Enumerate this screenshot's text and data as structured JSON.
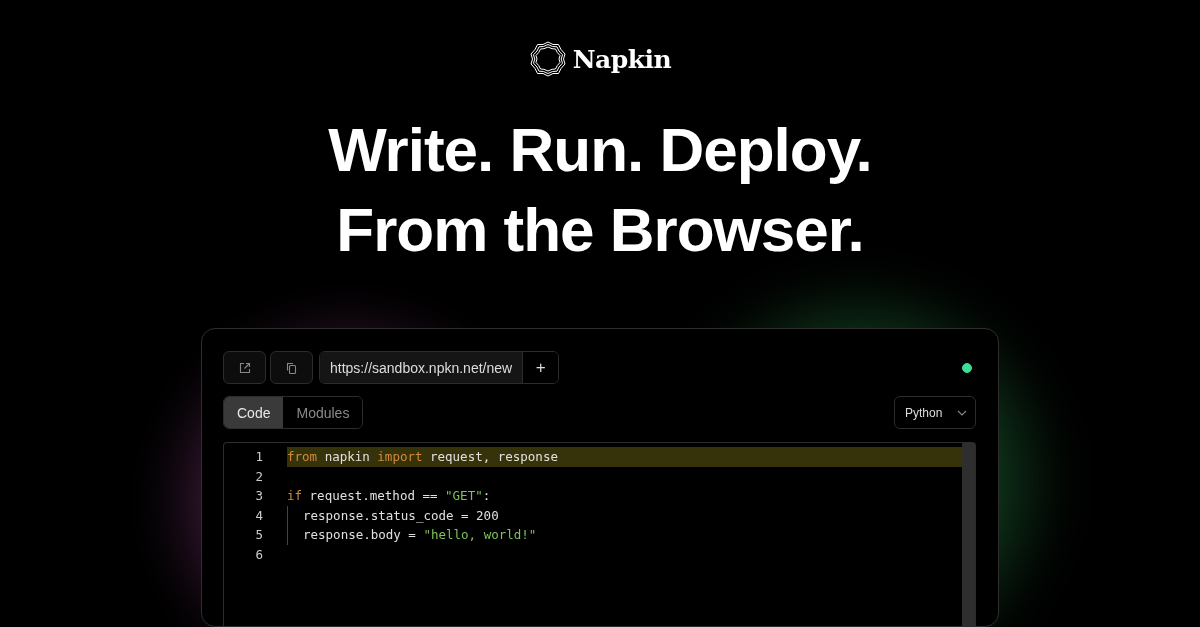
{
  "brand": {
    "name": "Napkin"
  },
  "headline": [
    "Write. Run. Deploy.",
    "From the Browser."
  ],
  "editor_window": {
    "toolbar": {
      "url": "https://sandbox.npkn.net/new",
      "add_label": "+",
      "connected": true
    },
    "tabs": [
      {
        "label": "Code",
        "selected": true
      },
      {
        "label": "Modules",
        "selected": false
      }
    ],
    "language": "Python",
    "lines": [
      {
        "number": "1",
        "active": true,
        "indented": false,
        "tokens": [
          {
            "kind": "keyword",
            "text": "from"
          },
          {
            "kind": "plain",
            "text": " napkin "
          },
          {
            "kind": "keyword",
            "text": "import"
          },
          {
            "kind": "plain",
            "text": " request, response"
          }
        ]
      },
      {
        "number": "2",
        "active": false,
        "indented": false
      },
      {
        "number": "3",
        "active": false,
        "indented": false,
        "tokens": [
          {
            "kind": "keyword",
            "text": "if"
          },
          {
            "kind": "plain",
            "text": " request.method == "
          },
          {
            "kind": "string",
            "text": "\"GET\""
          },
          {
            "kind": "plain",
            "text": ":"
          }
        ]
      },
      {
        "number": "4",
        "active": false,
        "indented": true,
        "tokens": [
          {
            "kind": "plain",
            "text": "response.status_code = 200"
          }
        ]
      },
      {
        "number": "5",
        "active": false,
        "indented": true,
        "tokens": [
          {
            "kind": "plain",
            "text": "response.body = "
          },
          {
            "kind": "string",
            "text": "\"hello, world!\""
          }
        ]
      },
      {
        "number": "6",
        "active": false,
        "indented": false
      }
    ]
  }
}
